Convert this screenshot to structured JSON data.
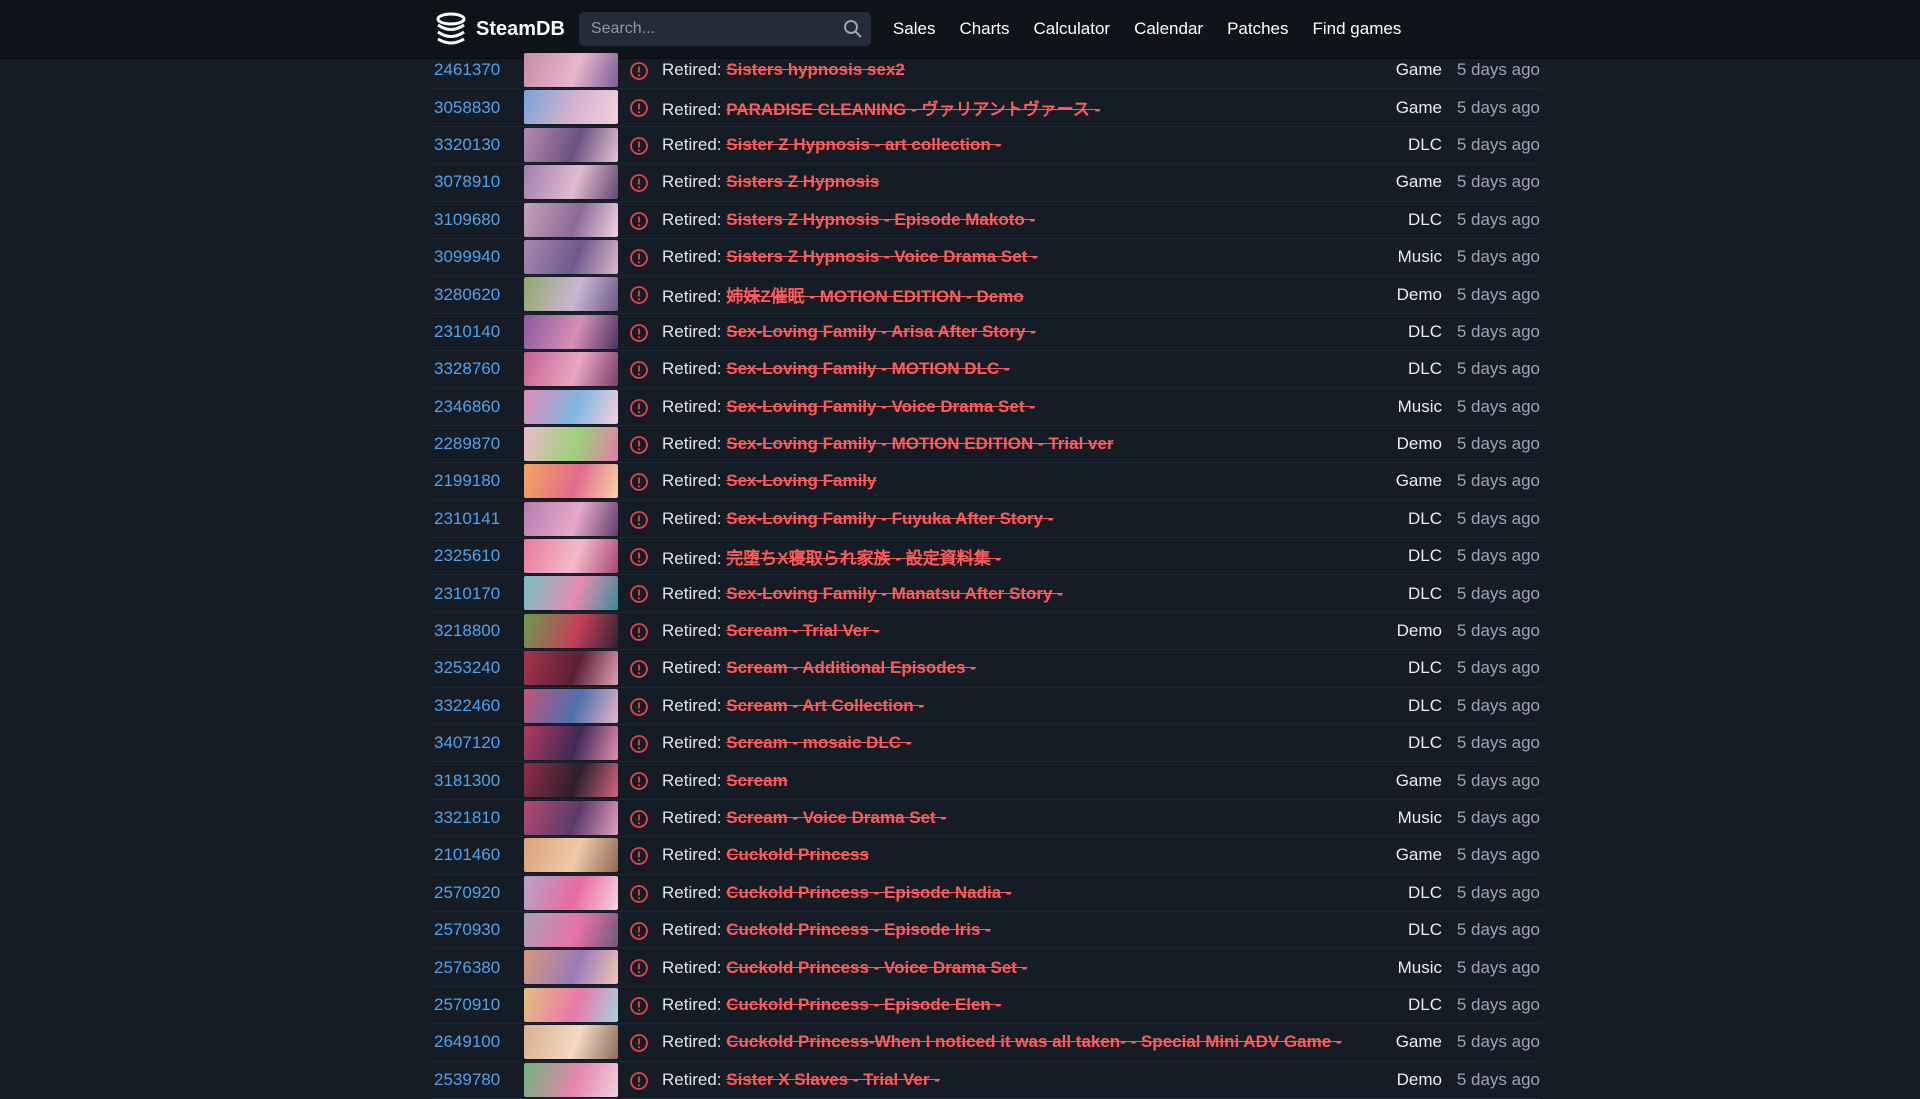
{
  "header": {
    "brand": "SteamDB",
    "search_placeholder": "Search...",
    "nav": [
      "Sales",
      "Charts",
      "Calculator",
      "Calendar",
      "Patches",
      "Find games"
    ]
  },
  "icons": {
    "logo": "steamdb-logo-icon",
    "search": "search-icon",
    "alert": "alert-circle-icon"
  },
  "colors": {
    "background": "#151c26",
    "topbar": "#0f141b",
    "appid_link": "#4fa3ec",
    "retired_name": "#ff5a5a",
    "alert_icon": "#e0474c"
  },
  "rows": [
    {
      "appid": "2461370",
      "label": "Retired:",
      "name": "Sisters hypnosis sex2",
      "type": "Game",
      "time": "5 days ago",
      "thumb": [
        "#c98ba8",
        "#e7b7c9",
        "#7a5f9a"
      ]
    },
    {
      "appid": "3058830",
      "label": "Retired:",
      "name": "PARADISE CLEANING - ヴァリアントヴァース -",
      "type": "Game",
      "time": "5 days ago",
      "thumb": [
        "#7aa3d6",
        "#d9b3cf",
        "#f2d2dc"
      ]
    },
    {
      "appid": "3320130",
      "label": "Retired:",
      "name": "Sister Z Hypnosis - art collection -",
      "type": "DLC",
      "time": "5 days ago",
      "thumb": [
        "#b58bb0",
        "#6a5380",
        "#e6c3d2"
      ]
    },
    {
      "appid": "3078910",
      "label": "Retired:",
      "name": "Sisters Z Hypnosis",
      "type": "Game",
      "time": "5 days ago",
      "thumb": [
        "#9f7fae",
        "#e2b9ce",
        "#5d4975"
      ]
    },
    {
      "appid": "3109680",
      "label": "Retired:",
      "name": "Sisters Z Hypnosis - Episode Makoto -",
      "type": "DLC",
      "time": "5 days ago",
      "thumb": [
        "#c9a2b8",
        "#8b6a97",
        "#f0d4df"
      ]
    },
    {
      "appid": "3099940",
      "label": "Retired:",
      "name": "Sisters Z Hypnosis - Voice Drama Set -",
      "type": "Music",
      "time": "5 days ago",
      "thumb": [
        "#a889b2",
        "#6f5a8d",
        "#dcb7c9"
      ]
    },
    {
      "appid": "3280620",
      "label": "Retired:",
      "name": "姉妹Z催眠 - MOTION EDITION - Demo",
      "type": "Demo",
      "time": "5 days ago",
      "thumb": [
        "#92a86a",
        "#c8b6d4",
        "#6c5886"
      ]
    },
    {
      "appid": "2310140",
      "label": "Retired:",
      "name": "Sex-Loving Family - Arisa After Story -",
      "type": "DLC",
      "time": "5 days ago",
      "thumb": [
        "#8a5a9e",
        "#d78fb4",
        "#4a3565"
      ]
    },
    {
      "appid": "3328760",
      "label": "Retired:",
      "name": "Sex-Loving Family - MOTION DLC -",
      "type": "DLC",
      "time": "5 days ago",
      "thumb": [
        "#c4608e",
        "#e8a7c1",
        "#7b3d6c"
      ]
    },
    {
      "appid": "2346860",
      "label": "Retired:",
      "name": "Sex-Loving Family - Voice Drama Set -",
      "type": "Music",
      "time": "5 days ago",
      "thumb": [
        "#e48bb4",
        "#7fb6e0",
        "#f5d1df"
      ]
    },
    {
      "appid": "2289870",
      "label": "Retired:",
      "name": "Sex-Loving Family - MOTION EDITION - Trial ver",
      "type": "Demo",
      "time": "5 days ago",
      "thumb": [
        "#f0b8cc",
        "#9bd17b",
        "#e77aa8"
      ]
    },
    {
      "appid": "2199180",
      "label": "Retired:",
      "name": "Sex-Loving Family",
      "type": "Game",
      "time": "5 days ago",
      "thumb": [
        "#f2a75e",
        "#e46a8c",
        "#f7d3a8"
      ]
    },
    {
      "appid": "2310141",
      "label": "Retired:",
      "name": "Sex-Loving Family - Fuyuka After Story -",
      "type": "DLC",
      "time": "5 days ago",
      "thumb": [
        "#b77db0",
        "#e7a8c7",
        "#5f3f6f"
      ]
    },
    {
      "appid": "2325610",
      "label": "Retired:",
      "name": "完堕ちX寝取られ家族 - 設定資料集 -",
      "type": "DLC",
      "time": "5 days ago",
      "thumb": [
        "#e97a9d",
        "#f3b9c9",
        "#a94874"
      ]
    },
    {
      "appid": "2310170",
      "label": "Retired:",
      "name": "Sex-Loving Family - Manatsu After Story -",
      "type": "DLC",
      "time": "5 days ago",
      "thumb": [
        "#6fc3c2",
        "#e78cb1",
        "#3b8b99"
      ]
    },
    {
      "appid": "3218800",
      "label": "Retired:",
      "name": "Scream - Trial Ver -",
      "type": "Demo",
      "time": "5 days ago",
      "thumb": [
        "#6a9c4f",
        "#c73f5a",
        "#2e2433"
      ]
    },
    {
      "appid": "3253240",
      "label": "Retired:",
      "name": "Scream - Additional Episodes -",
      "type": "DLC",
      "time": "5 days ago",
      "thumb": [
        "#a8344f",
        "#5b1f36",
        "#e2a0b4"
      ]
    },
    {
      "appid": "3322460",
      "label": "Retired:",
      "name": "Scream - Art Collection -",
      "type": "DLC",
      "time": "5 days ago",
      "thumb": [
        "#c0567a",
        "#4f6fae",
        "#e8b4c6"
      ]
    },
    {
      "appid": "3407120",
      "label": "Retired:",
      "name": "Scream - mosaic DLC -",
      "type": "DLC",
      "time": "5 days ago",
      "thumb": [
        "#b33a5f",
        "#3f2a55",
        "#e490b0"
      ]
    },
    {
      "appid": "3181300",
      "label": "Retired:",
      "name": "Scream",
      "type": "Game",
      "time": "5 days ago",
      "thumb": [
        "#8f2e48",
        "#2d1f2c",
        "#d2657f"
      ]
    },
    {
      "appid": "3321810",
      "label": "Retired:",
      "name": "Scream - Voice Drama Set -",
      "type": "Music",
      "time": "5 days ago",
      "thumb": [
        "#b04a6e",
        "#5c3b6b",
        "#e3a1bb"
      ]
    },
    {
      "appid": "2101460",
      "label": "Retired:",
      "name": "Cuckold Princess",
      "type": "Game",
      "time": "5 days ago",
      "thumb": [
        "#d9a27a",
        "#f0c9a8",
        "#8e6a56"
      ]
    },
    {
      "appid": "2570920",
      "label": "Retired:",
      "name": "Cuckold Princess - Episode Nadia -",
      "type": "DLC",
      "time": "5 days ago",
      "thumb": [
        "#b7a4c7",
        "#e86aa0",
        "#f2d6e2"
      ]
    },
    {
      "appid": "2570930",
      "label": "Retired:",
      "name": "Cuckold Princess - Episode Iris -",
      "type": "DLC",
      "time": "5 days ago",
      "thumb": [
        "#a8a0b8",
        "#e872a6",
        "#6e5a7e"
      ]
    },
    {
      "appid": "2576380",
      "label": "Retired:",
      "name": "Cuckold Princess - Voice Drama Set -",
      "type": "Music",
      "time": "5 days ago",
      "thumb": [
        "#d49a7a",
        "#9c7ab8",
        "#f0c7b2"
      ]
    },
    {
      "appid": "2570910",
      "label": "Retired:",
      "name": "Cuckold Princess - Episode Elen -",
      "type": "DLC",
      "time": "5 days ago",
      "thumb": [
        "#e3c07d",
        "#e879a9",
        "#a9d1e6"
      ]
    },
    {
      "appid": "2649100",
      "label": "Retired:",
      "name": "Cuckold Princess-When I noticed it was all taken- - Special Mini ADV Game -",
      "type": "Game",
      "time": "5 days ago",
      "thumb": [
        "#d8b08a",
        "#f2d9c3",
        "#8d6e5e"
      ]
    },
    {
      "appid": "2539780",
      "label": "Retired:",
      "name": "Sister X Slaves - Trial Ver -",
      "type": "Demo",
      "time": "5 days ago",
      "thumb": [
        "#6fb37c",
        "#e685ac",
        "#f1d0dc"
      ]
    }
  ]
}
